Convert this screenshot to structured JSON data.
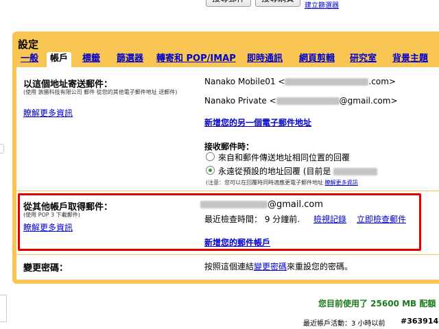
{
  "top": {
    "button_1": "搜尋郵件",
    "button_2": "搜尋網頁",
    "link": "建立篩選器"
  },
  "settings": {
    "title": "設定",
    "tabs": [
      {
        "label": "一般"
      },
      {
        "label": "帳戶"
      },
      {
        "label": "標籤"
      },
      {
        "label": "篩選器"
      },
      {
        "label": "轉寄和 POP/IMAP"
      },
      {
        "label": "即時通訊"
      },
      {
        "label": "網頁剪輯"
      },
      {
        "label": "研究室"
      },
      {
        "label": "背景主題"
      }
    ]
  },
  "send_as": {
    "title": "以這個地址寄送郵件：",
    "subtitle": "(使用 敦勝科技有限公司 郵件 從您的其他電子郵件地址 送郵件)",
    "learn_more": "瞭解更多資訊",
    "address_1_name": "Nanako Mobile01 <",
    "address_1_suffix": ".com>",
    "address_2_name": "Nanako Private <",
    "address_2_suffix": "@gmail.com>",
    "add_address": "新增您的另一個電子郵件地址",
    "reply_title": "接收郵件時：",
    "reply_option_1": "來自和郵件傳送地址相同位置的回覆",
    "reply_option_2": "永遠從預設的地址回覆 (目前是",
    "note": "(注意：您可以在回覆時同時適應更電子郵件地址",
    "note_link": "瞭解更多資訊"
  },
  "get_mail": {
    "title": "從其他帳戶取得郵件：",
    "subtitle": "(使用 POP 3 下載郵件)",
    "learn_more": "瞭解更多資訊",
    "account_suffix": "@gmail.com",
    "last_check_label": "最近檢查時間：",
    "last_check_value": "9 分鐘前.",
    "view_history": "檢視記錄",
    "check_now": "立即檢查郵件",
    "add_account": "新增您的郵件帳戶"
  },
  "change_password": {
    "title": "變更密碼：",
    "text_before": "按照這個連結",
    "link": "變更密碼",
    "text_after": "來重設您的密碼。"
  },
  "footer": {
    "usage": "您目前使用了 25600 MB 配額",
    "activity": "最近帳戶活動：3 小時以前",
    "watermark": "#363914"
  },
  "colors": {
    "settings_frame": "#f9c654",
    "highlight_border": "#e00000",
    "link": "#0000cc",
    "usage_text": "#1a7a1a"
  }
}
